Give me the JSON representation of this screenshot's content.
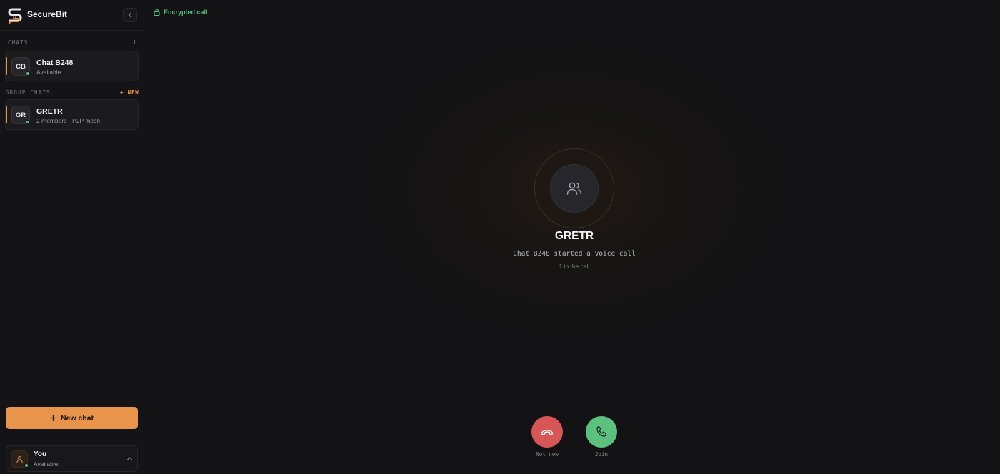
{
  "app": {
    "name": "SecureBit",
    "accent_color": "#e8913e",
    "online_color": "#4ec27a"
  },
  "sidebar": {
    "chats_label": "CHATS",
    "chats_count": "1",
    "chats": [
      {
        "initials": "CB",
        "name": "Chat B248",
        "status": "Available",
        "online": true
      }
    ],
    "group_chats_label": "GROUP CHATS",
    "new_group_label": "+ NEW",
    "groups": [
      {
        "initials": "GR",
        "name": "GRETR",
        "subtitle": "2 members · P2P mesh",
        "online": true
      }
    ],
    "new_chat_button": "New chat",
    "profile": {
      "name": "You",
      "status": "Available"
    }
  },
  "call": {
    "encrypted_label": "Encrypted call",
    "group_name": "GRETR",
    "message": "Chat B248 started a voice call",
    "participants": "1 in the call",
    "decline_label": "Not now",
    "join_label": "Join",
    "decline_color": "#d85656",
    "join_color": "#5cc17e",
    "icons": {
      "avatar": "users-icon",
      "decline": "phone-hangup-icon",
      "join": "phone-icon",
      "lock": "lock-icon"
    }
  }
}
